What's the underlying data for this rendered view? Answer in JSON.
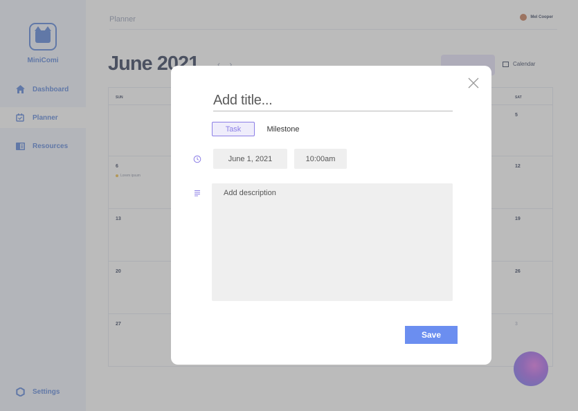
{
  "app": {
    "name": "MiniComi"
  },
  "sidebar": {
    "items": [
      {
        "label": "Dashboard",
        "icon": "home-icon"
      },
      {
        "label": "Planner",
        "icon": "calendar-check-icon",
        "active": true
      },
      {
        "label": "Resources",
        "icon": "book-icon"
      }
    ],
    "settings_label": "Settings"
  },
  "header": {
    "breadcrumb": "Planner",
    "user_name": "Mel Cooper"
  },
  "calendar": {
    "month_title": "June 2021",
    "view_label": "Calendar",
    "day_headers": [
      "SUN",
      "SAT"
    ],
    "left_dates": [
      "",
      "6",
      "13",
      "20",
      "27"
    ],
    "left_first_muted": "",
    "right_dates": [
      "5",
      "12",
      "19",
      "26",
      "3"
    ],
    "event_label": "Lorem ipsum"
  },
  "modal": {
    "title_placeholder": "Add title...",
    "type_task": "Task",
    "type_milestone": "Milestone",
    "date_value": "June 1, 2021",
    "time_value": "10:00am",
    "description_placeholder": "Add description",
    "save_label": "Save"
  },
  "colors": {
    "accent": "#4a78d6",
    "task_purple": "#8b7ee6",
    "save_blue": "#6b8ef0",
    "sidebar_bg": "#eef3fd"
  }
}
